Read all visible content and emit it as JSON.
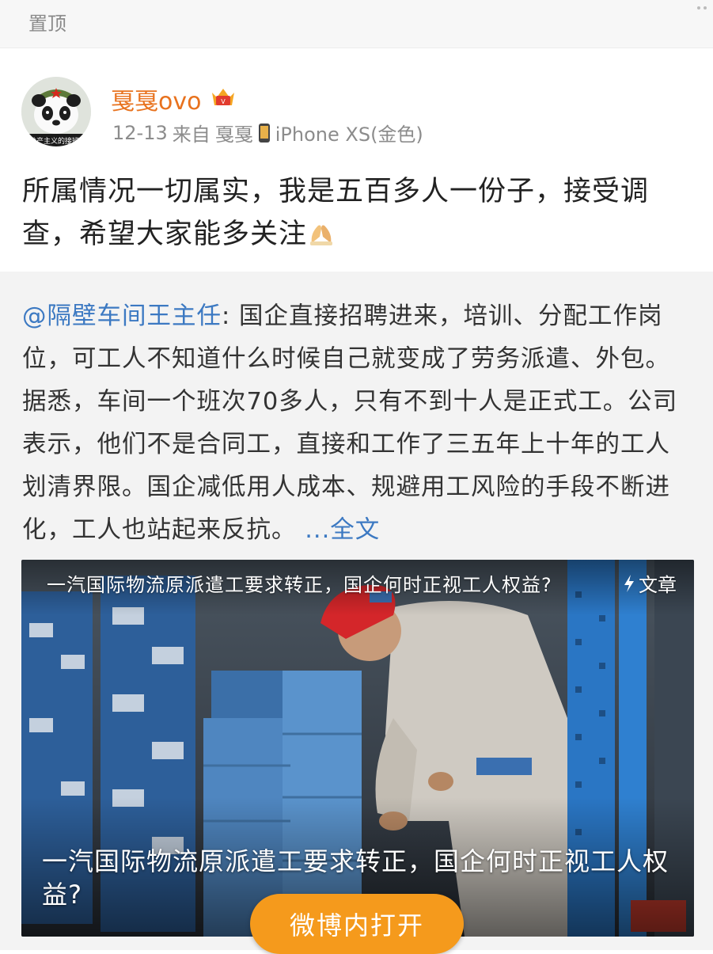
{
  "pinned_label": "置顶",
  "post": {
    "user_name": "戛戛ovo",
    "date": "12-13",
    "source_prefix": "来自",
    "source_name": "戛戛",
    "device": "iPhone XS(金色)",
    "avatar_caption": "共产主义的接班",
    "text": "所属情况一切属实，我是五百多人一份子，接受调查，希望大家能多关注",
    "emoji": "folded-hands-emoji"
  },
  "repost": {
    "mention": "@隔壁车间王主任",
    "separator": ": ",
    "text": "国企直接招聘进来，培训、分配工作岗位，可工人不知道什么时候自己就变成了劳务派遣、外包。据悉，车间一个班次70多人，只有不到十人是正式工。公司表示，他们不是合同工，直接和工作了三五年上十年的工人划清界限。国企减低用人成本、规避用工风险的手段不断进化，工人也站起来反抗。 ",
    "more_label": "...全文"
  },
  "article_card": {
    "top_title": "一汽国际物流原派遣工要求转正，国企何时正视工人权益?",
    "tag_label": "文章",
    "main_title": "一汽国际物流原派遣工要求转正，国企何时正视工人权益?"
  },
  "open_button_label": "微博内打开",
  "colors": {
    "username": "#e8721e",
    "link": "#3c79c2",
    "button": "#f59a1c",
    "repost_bg": "#f3f3f3"
  }
}
